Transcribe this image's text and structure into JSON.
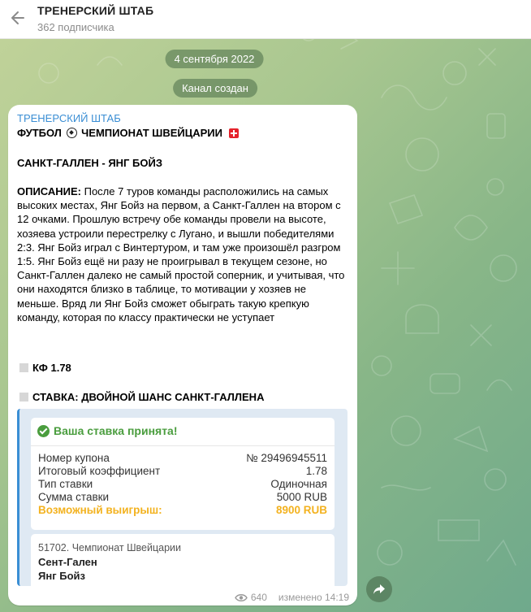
{
  "header": {
    "title": "ТРЕНЕРСКИЙ ШТАБ",
    "subtitle": "362 подписчика"
  },
  "service": {
    "date": "4 сентября 2022",
    "created": "Канал создан"
  },
  "post": {
    "channel": "ТРЕНЕРСКИЙ ШТАБ",
    "headline_left": "ФУТБОЛ",
    "headline_right": "ЧЕМПИОНАТ ШВЕЙЦАРИИ",
    "match": "САНКТ-ГАЛЛЕН - ЯНГ БОЙЗ",
    "desc_label": "ОПИСАНИЕ:",
    "desc_text": " После 7 туров команды расположились на самых высоких местах, Янг Бойз на первом, а Санкт-Галлен на втором с 12 очками. Прошлую встречу обе команды провели на высоте, хозяева устроили перестрелку с Лугано, и вышли победителями 2:3. Янг Бойз играл с Винтертуром, и там уже произошёл разгром 1:5. Янг Бойз ещё ни разу не проигрывал в текущем сезоне, но Санкт-Галлен далеко не самый простой соперник, и учитывая, что они находятся близко в таблице, то мотивации у хозяев не меньше. Вряд ли Янг Бойз сможет обыграть такую крепкую команду, которая по классу практически не уступает",
    "odds": "КФ 1.78",
    "bet": "СТАВКА: ДВОЙНОЙ ШАНС САНКТ-ГАЛЛЕНА",
    "card": {
      "accepted": "Ваша ставка принята!",
      "rows": [
        {
          "label": "Номер купона",
          "value": "№ 29496945511"
        },
        {
          "label": "Итоговый коэффициент",
          "value": "1.78"
        },
        {
          "label": "Тип ставки",
          "value": "Одиночная"
        },
        {
          "label": "Сумма ставки",
          "value": "5000 RUB"
        }
      ],
      "win_label": "Возможный выигрыш:",
      "win_value": "8900 RUB",
      "championship": "51702. Чемпионат Швейцарии",
      "team1": "Сент-Гален",
      "team2": "Янг Бойз"
    },
    "views": "640",
    "edited": "изменено 14:19"
  },
  "colors": {
    "accent": "#3a8ed4",
    "success": "#4a9d3e",
    "win": "#f3b21f"
  },
  "icons": [
    "back-arrow-icon",
    "soccer-ball-icon",
    "swiss-flag-icon",
    "check-circle-icon",
    "eye-icon",
    "share-icon"
  ]
}
